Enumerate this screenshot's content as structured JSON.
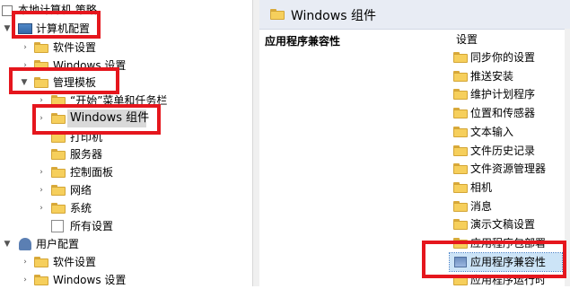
{
  "left_tree": {
    "root_label": "本地计算机 策略",
    "computer_config": "计算机配置",
    "software_settings": "软件设置",
    "windows_settings": "Windows 设置",
    "admin_templates": "管理模板",
    "start_menu": "“开始”菜单和任务栏",
    "windows_components": "Windows 组件",
    "printers": "打印机",
    "server": "服务器",
    "control_panel": "控制面板",
    "network": "网络",
    "system": "系统",
    "all_settings": "所有设置",
    "user_config": "用户配置",
    "user_software_settings": "软件设置",
    "user_windows_settings": "Windows 设置"
  },
  "right_pane": {
    "header_title": "Windows 组件",
    "section_title": "应用程序兼容性",
    "column_header": "设置",
    "items": [
      "同步你的设置",
      "推送安装",
      "维护计划程序",
      "位置和传感器",
      "文本输入",
      "文件历史记录",
      "文件资源管理器",
      "相机",
      "消息",
      "演示文稿设置",
      "应用程序包部署",
      "应用程序兼容性",
      "应用程序运行时"
    ],
    "selected_index": 11
  },
  "colors": {
    "highlight_box": "#e5161d",
    "selection": "#cce4f7",
    "folder": "#f6cf5c"
  }
}
